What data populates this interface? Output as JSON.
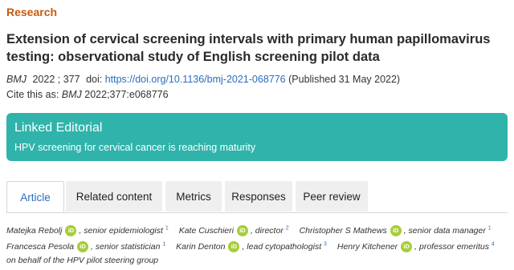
{
  "article": {
    "section": "Research",
    "title": "Extension of cervical screening intervals with primary human papillomavirus testing: observational study of English screening pilot data",
    "journal": "BMJ",
    "year_volume": "2022 ; 377",
    "doi_label": "doi:",
    "doi": "https://doi.org/10.1136/bmj-2021-068776",
    "published": "(Published 31 May 2022)",
    "cite_label": "Cite this as:",
    "cite_ref": "2022;377:e068776"
  },
  "linked_editorial": {
    "heading": "Linked Editorial",
    "link": "HPV screening for cervical cancer is reaching maturity"
  },
  "tabs": [
    {
      "label": "Article",
      "active": true
    },
    {
      "label": "Related content",
      "active": false
    },
    {
      "label": "Metrics",
      "active": false
    },
    {
      "label": "Responses",
      "active": false
    },
    {
      "label": "Peer review",
      "active": false
    }
  ],
  "authors": [
    {
      "name": "Matejka Rebolj",
      "orcid": true,
      "role": ", senior epidemiologist",
      "aff": "1"
    },
    {
      "name": "Kate Cuschieri",
      "orcid": true,
      "role": ", director",
      "aff": "2"
    },
    {
      "name": "Christopher S Mathews",
      "orcid": true,
      "role": ", senior data manager",
      "aff": "1"
    },
    {
      "name": "Francesca Pesola",
      "orcid": true,
      "role": ", senior statistician",
      "aff": "1"
    },
    {
      "name": "Karin Denton",
      "orcid": true,
      "role": ", lead cytopathologist",
      "aff": "3"
    },
    {
      "name": "Henry Kitchener",
      "orcid": true,
      "role": ", professor emeritus",
      "aff": "4"
    }
  ],
  "orcid_badge": "iD",
  "on_behalf": "on behalf of the HPV pilot steering group",
  "colors": {
    "section": "#c55a11",
    "editorial_bg": "#2fb3ab",
    "link": "#2a6ebb",
    "orcid": "#a6ce39",
    "tab_bg": "#efefef"
  }
}
